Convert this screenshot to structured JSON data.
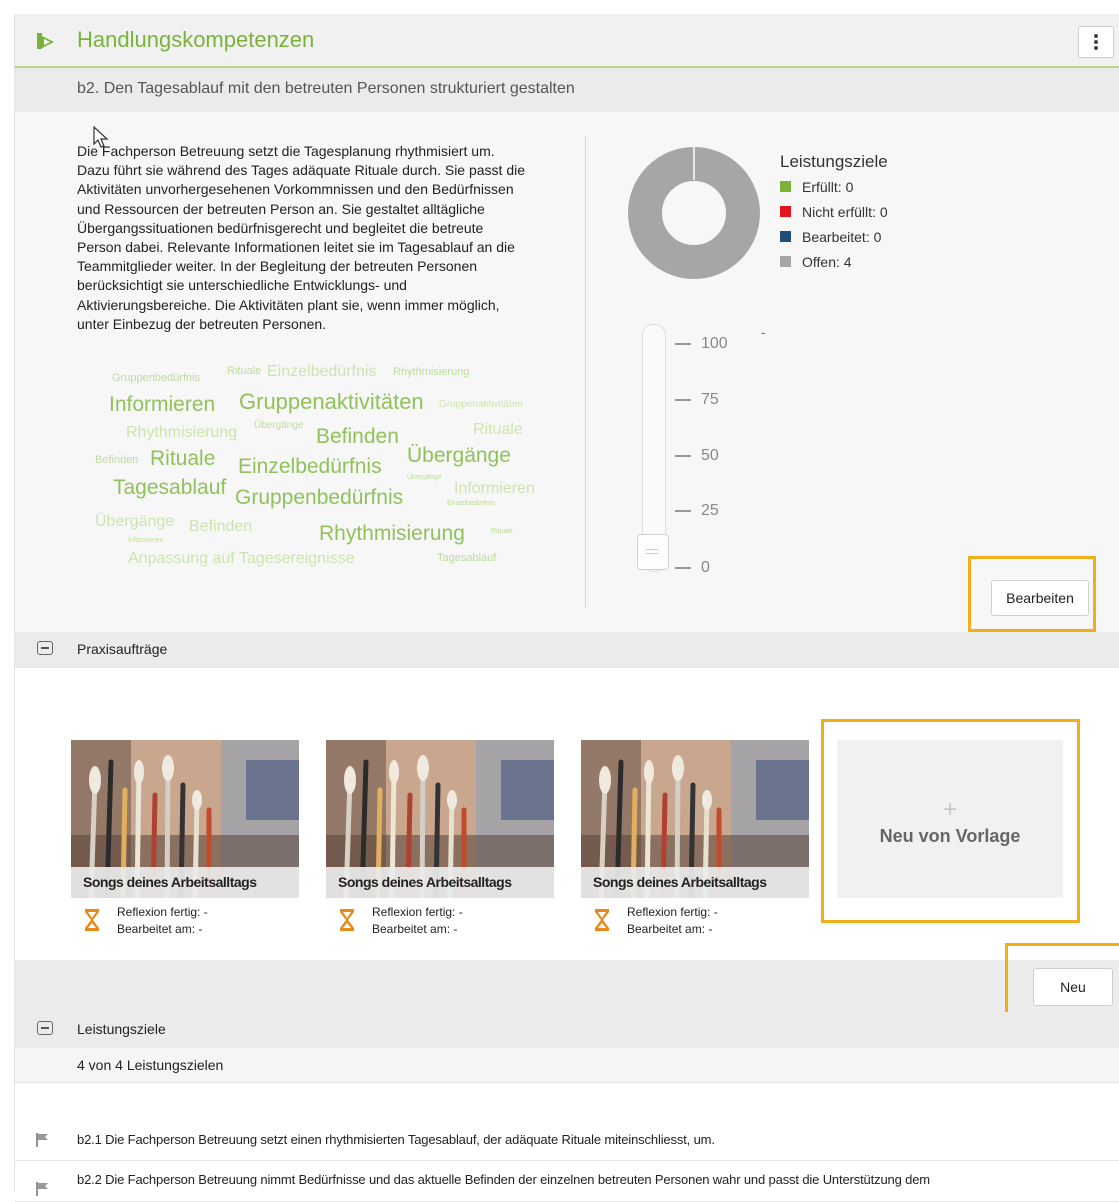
{
  "header": {
    "title": "Handlungskompetenzen",
    "menu_icon": "vertical-dots-icon"
  },
  "competence": {
    "title": "b2. Den Tagesablauf mit den betreuten Personen strukturiert gestalten",
    "description_lines": [
      "Die Fachperson Betreuung setzt die Tagesplanung rhythmisiert um.",
      "Dazu führt sie während des Tages adäquate Rituale durch. Sie passt die",
      "Aktivitäten unvorhergesehenen Vorkommnissen und den Bedürfnissen",
      "und Ressourcen der betreuten Person an. Sie gestaltet alltägliche",
      "Übergangssituationen bedürfnisgerecht und begleitet die betreute",
      "Person dabei. Relevante Informationen leitet sie im Tagesablauf an die",
      "Teammitglieder weiter. In der Begleitung der betreuten Personen",
      "berücksichtigt sie unterschiedliche Entwicklungs- und",
      "Aktivierungsbereiche. Die Aktivitäten plant sie, wenn immer möglich,",
      "unter Einbezug der betreuten Personen."
    ],
    "word_cloud": [
      "Gruppenbedürfnis",
      "Rituale",
      "Einzelbedürfnis",
      "Rhythmisierung",
      "Informieren",
      "Gruppenaktivitäten",
      "Gruppenaktivitäten",
      "Rhythmisierung",
      "Übergänge",
      "Befinden",
      "Rituale",
      "Befinden",
      "Rituale",
      "Einzelbedürfnis",
      "Übergänge",
      "Übergänge",
      "Tagesablauf",
      "Gruppenbedürfnis",
      "Informieren",
      "Einzelbedürfnis",
      "Übergänge",
      "Befinden",
      "Rhythmisierung",
      "Rituale",
      "Informieren",
      "Anpassung auf Tagesereignisse",
      "Tagesablauf"
    ],
    "legend": {
      "title": "Leistungsziele",
      "items": [
        {
          "label": "Erfüllt:",
          "value": "0",
          "color": "#7ab33a"
        },
        {
          "label": "Nicht erfüllt:",
          "value": "0",
          "color": "#e3141c"
        },
        {
          "label": "Bearbeitet:",
          "value": "0",
          "color": "#1f4e79"
        },
        {
          "label": "Offen:",
          "value": "4",
          "color": "#a6a6a6"
        }
      ]
    },
    "slider": {
      "ticks": [
        "100",
        "75",
        "50",
        "25",
        "0"
      ],
      "extra": "-",
      "value": 0
    },
    "edit_button": "Bearbeiten"
  },
  "practice": {
    "section_label": "Praxisaufträge",
    "cards": [
      {
        "title": "Songs deines Arbeitsalltags",
        "reflexion": "Reflexion fertig: -",
        "edited": "Bearbeitet am: -",
        "icon": "hourglass-icon"
      },
      {
        "title": "Songs deines Arbeitsalltags",
        "reflexion": "Reflexion fertig: -",
        "edited": "Bearbeitet am: -",
        "icon": "hourglass-icon"
      },
      {
        "title": "Songs deines Arbeitsalltags",
        "reflexion": "Reflexion fertig: -",
        "edited": "Bearbeitet am: -",
        "icon": "hourglass-icon"
      }
    ],
    "template_plus": "+",
    "template_label": "Neu von Vorlage",
    "new_button": "Neu"
  },
  "goals": {
    "section_label": "Leistungsziele",
    "count_text": "4 von 4 Leistungszielen",
    "items": [
      "b2.1 Die Fachperson Betreuung setzt einen rhythmisierten Tagesablauf, der adäquate Rituale miteinschliesst, um.",
      "b2.2 Die Fachperson Betreuung nimmt Bedürfnisse und das aktuelle Befinden der einzelnen betreuten Personen wahr und passt die Unterstützung dem"
    ]
  }
}
